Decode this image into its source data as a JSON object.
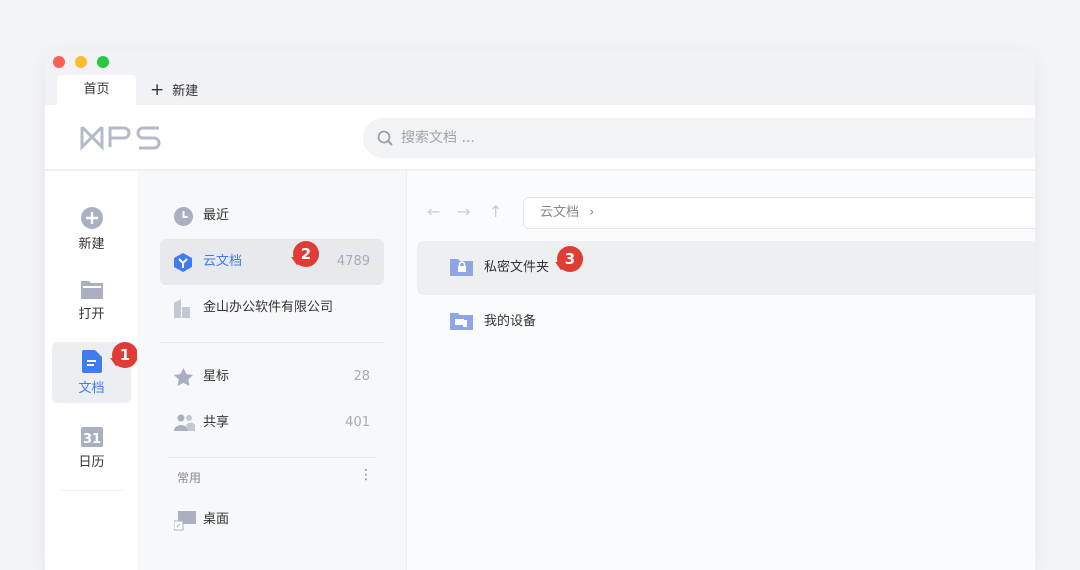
{
  "tabs": {
    "home": "首页",
    "new": "新建",
    "plus": "+"
  },
  "header": {
    "logo": "WPS",
    "search_placeholder": "搜索文档 ..."
  },
  "rail": [
    {
      "label": "新建"
    },
    {
      "label": "打开"
    },
    {
      "label": "文档"
    },
    {
      "label": "日历"
    }
  ],
  "panel": {
    "recent": "最近",
    "cloud": {
      "label": "云文档",
      "count": "4789"
    },
    "company": "金山办公软件有限公司",
    "star": {
      "label": "星标",
      "count": "28"
    },
    "share": {
      "label": "共享",
      "count": "401"
    },
    "common": "常用",
    "more": "⋮",
    "desktop": "桌面"
  },
  "content": {
    "breadcrumb": "云文档",
    "chevron": "›",
    "back": "←",
    "forward": "→",
    "up": "↑",
    "rows": [
      "私密文件夹",
      "我的设备"
    ]
  },
  "badges": [
    "1",
    "2",
    "3"
  ],
  "colors": {
    "accent": "#3f7cf0",
    "badge": "#e03c36",
    "icon": "#aab0c2",
    "folder": "#8ea6e8"
  }
}
